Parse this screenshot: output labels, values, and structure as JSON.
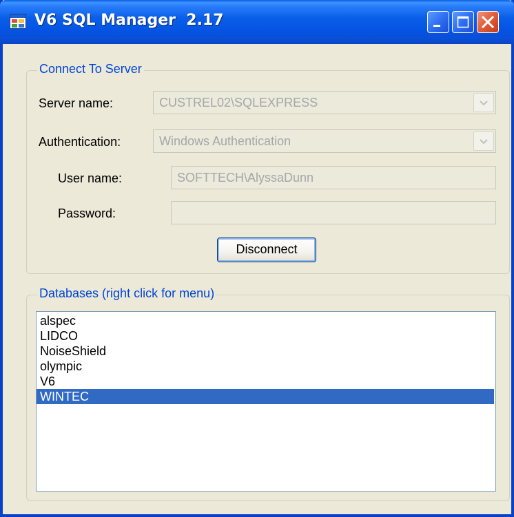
{
  "window": {
    "title": "V6 SQL Manager  2.17"
  },
  "connect_group": {
    "legend": "Connect To Server",
    "server_name_label": "Server name:",
    "server_name_value": "CUSTREL02\\SQLEXPRESS",
    "authentication_label": "Authentication:",
    "authentication_value": "Windows Authentication",
    "user_name_label": "User name:",
    "user_name_value": "SOFTTECH\\AlyssaDunn",
    "password_label": "Password:",
    "password_value": "",
    "disconnect_label": "Disconnect"
  },
  "databases_group": {
    "legend": "Databases (right click for menu)",
    "items": [
      {
        "label": "alspec",
        "selected": false
      },
      {
        "label": "LIDCO",
        "selected": false
      },
      {
        "label": "NoiseShield",
        "selected": false
      },
      {
        "label": "olympic",
        "selected": false
      },
      {
        "label": "V6",
        "selected": false
      },
      {
        "label": "WINTEC",
        "selected": true
      }
    ]
  },
  "colors": {
    "titlebar": "#0a5fe8",
    "group_legend": "#0046d5",
    "selection": "#316ac5",
    "window_face": "#ece9d8"
  },
  "icons": {
    "app": "app-window-icon",
    "minimize": "minimize-icon",
    "maximize": "maximize-icon",
    "close": "close-icon",
    "dropdown": "chevron-down-icon"
  }
}
